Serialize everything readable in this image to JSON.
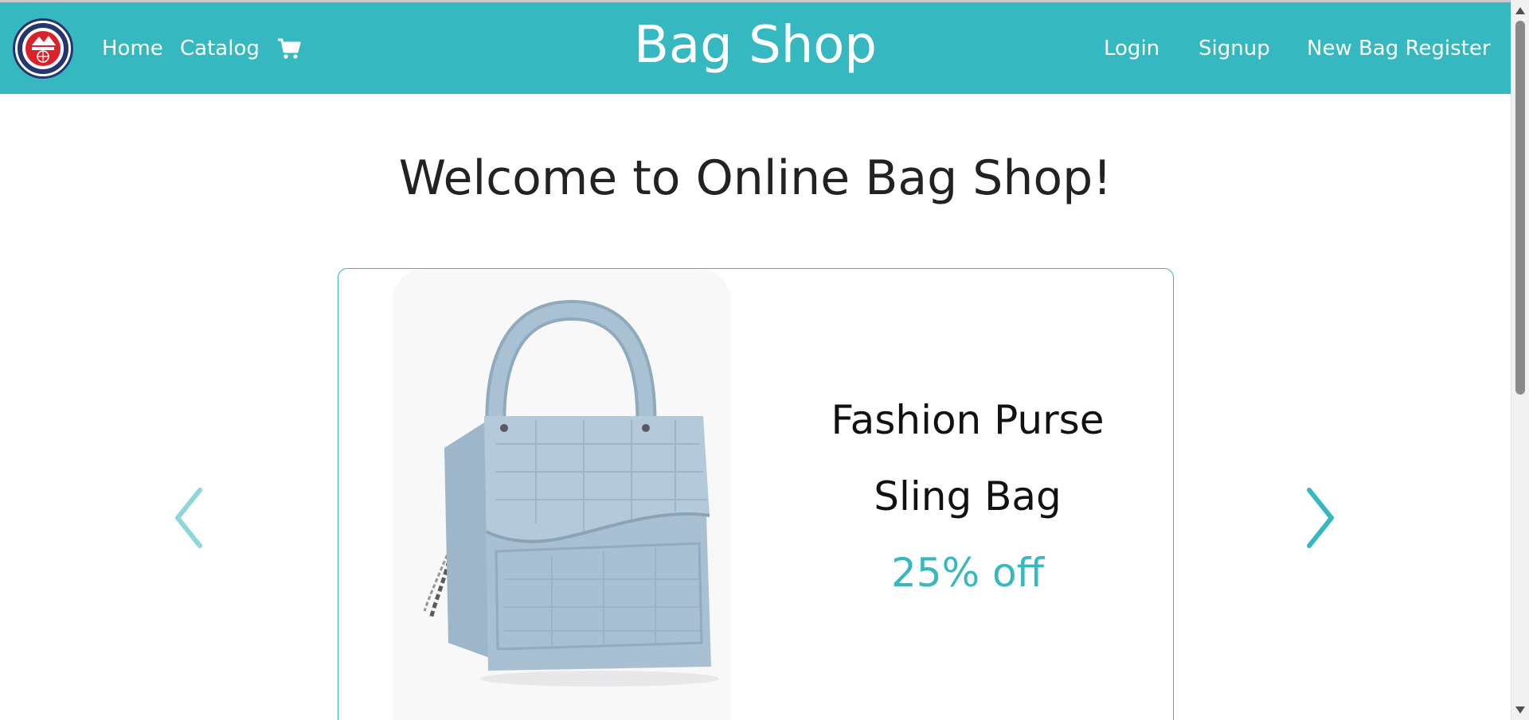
{
  "header": {
    "logo": "ala-too-university-logo",
    "nav_left": {
      "home_label": "Home",
      "catalog_label": "Catalog",
      "cart_icon": "shopping-cart-icon"
    },
    "brand": "Bag Shop",
    "nav_right": {
      "login_label": "Login",
      "signup_label": "Signup",
      "register_label": "New Bag Register"
    }
  },
  "main": {
    "welcome": "Welcome to Online Bag Shop!",
    "carousel": {
      "prev_icon": "chevron-left-icon",
      "next_icon": "chevron-right-icon",
      "slide": {
        "image": "light-blue-croc-handbag-image",
        "name_line1": "Fashion Purse",
        "name_line2": "Sling Bag",
        "discount": "25% off"
      }
    }
  },
  "colors": {
    "accent": "#36b8c0",
    "text_dark": "#222222",
    "background": "#ffffff"
  }
}
